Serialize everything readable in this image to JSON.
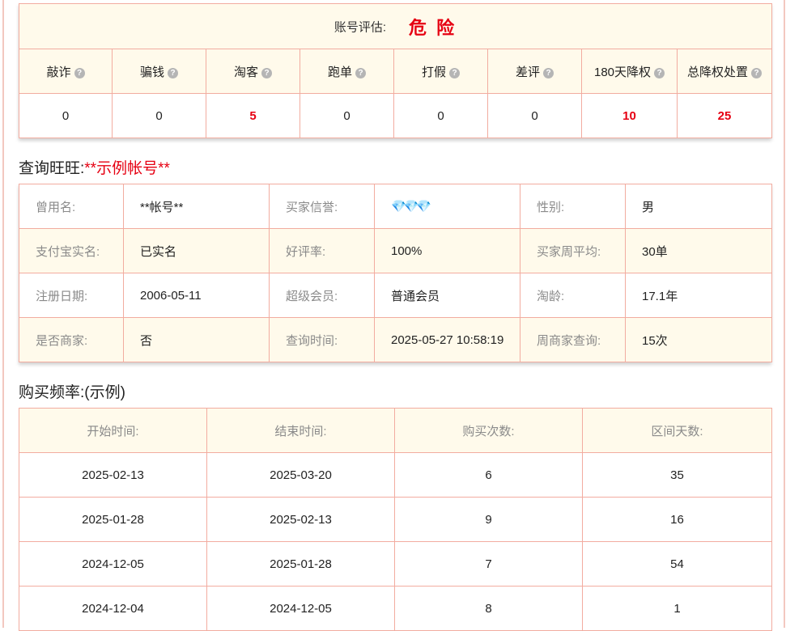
{
  "risk_summary": {
    "label": "账号评估:",
    "verdict": "危 险",
    "colors": {
      "hot": "#e60012",
      "header_bg": "#fffaeb",
      "border": "#f2aca0"
    },
    "help_icon": "question-circle-icon",
    "metrics": [
      {
        "label": "敲诈",
        "value": "0"
      },
      {
        "label": "骗钱",
        "value": "0"
      },
      {
        "label": "淘客",
        "value": "5"
      },
      {
        "label": "跑单",
        "value": "0"
      },
      {
        "label": "打假",
        "value": "0"
      },
      {
        "label": "差评",
        "value": "0"
      },
      {
        "label": "180天降权",
        "value": "10"
      },
      {
        "label": "总降权处置",
        "value": "25"
      }
    ]
  },
  "account_section": {
    "title_prefix": "查询旺旺:",
    "title_account": "**示例帐号**",
    "gem_icon": "diamond-icon",
    "gems": "💎💎💎",
    "rows": [
      [
        {
          "k": "曾用名:",
          "v": "**帐号**"
        },
        {
          "k": "买家信誉:",
          "v": ""
        },
        {
          "k": "性别:",
          "v": "男"
        }
      ],
      [
        {
          "k": "支付宝实名:",
          "v": "已实名"
        },
        {
          "k": "好评率:",
          "v": "100%"
        },
        {
          "k": "买家周平均:",
          "v": "30单"
        }
      ],
      [
        {
          "k": "注册日期:",
          "v": "2006-05-11"
        },
        {
          "k": "超级会员:",
          "v": "普通会员"
        },
        {
          "k": "淘龄:",
          "v": "17.1年"
        }
      ],
      [
        {
          "k": "是否商家:",
          "v": "否"
        },
        {
          "k": "查询时间:",
          "v": "2025-05-27 10:58:19"
        },
        {
          "k": "周商家查询:",
          "v": "15次"
        }
      ]
    ]
  },
  "frequency_section": {
    "title": "购买频率:(示例)",
    "headers": [
      "开始时间:",
      "结束时间:",
      "购买次数:",
      "区间天数:"
    ],
    "rows": [
      [
        "2025-02-13",
        "2025-03-20",
        "6",
        "35"
      ],
      [
        "2025-01-28",
        "2025-02-13",
        "9",
        "16"
      ],
      [
        "2024-12-05",
        "2025-01-28",
        "7",
        "54"
      ],
      [
        "2024-12-04",
        "2024-12-05",
        "8",
        "1"
      ]
    ]
  }
}
